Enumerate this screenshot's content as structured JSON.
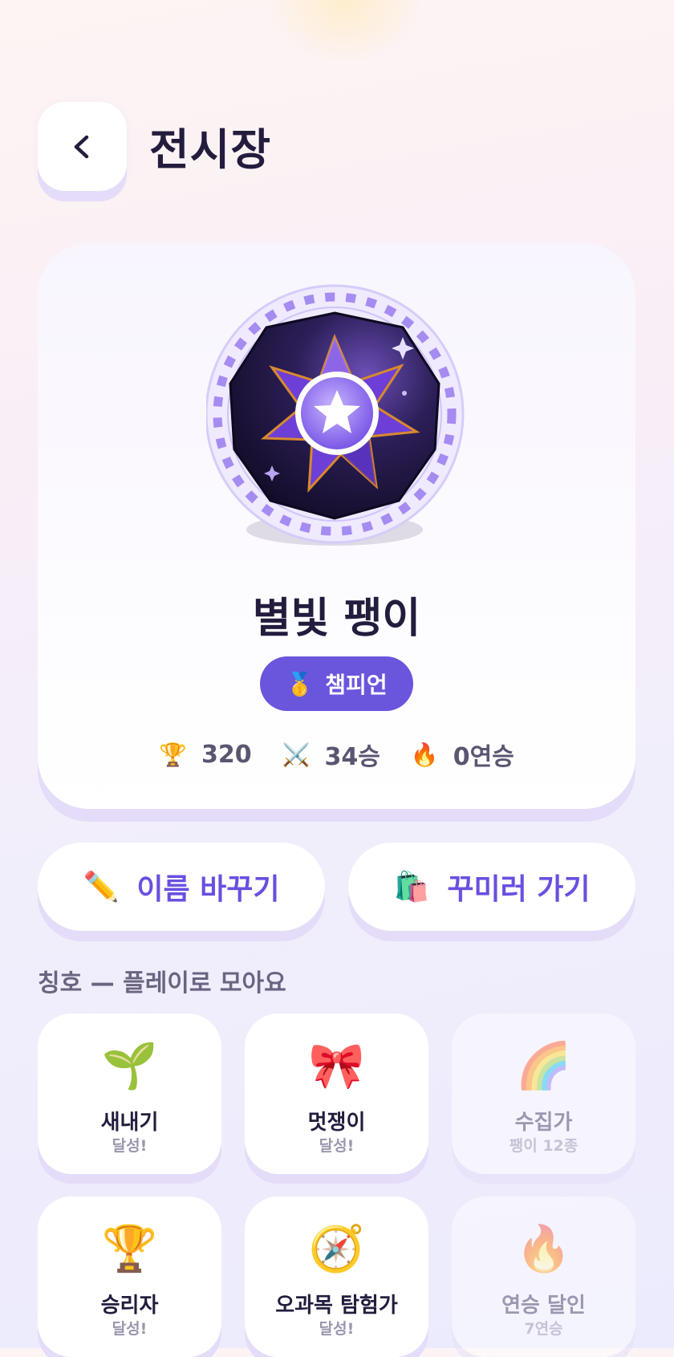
{
  "header": {
    "title": "전시장",
    "back_icon": "chevron-left-icon"
  },
  "profile": {
    "name": "별빛 팽이",
    "rank": {
      "icon": "🥇",
      "label": "챔피언"
    },
    "stats": [
      {
        "icon": "🏆",
        "icon_name": "trophy-icon",
        "value": "320"
      },
      {
        "icon": "⚔️",
        "icon_name": "crossed-swords-icon",
        "value": "34승"
      },
      {
        "icon": "🔥",
        "icon_name": "fire-icon",
        "value": "0연승"
      }
    ],
    "emblem_icon": "star-spinner-emblem-icon"
  },
  "actions": {
    "rename": {
      "icon": "✏️",
      "label": "이름 바꾸기"
    },
    "decorate": {
      "icon": "🛍️",
      "label": "꾸미러 가기"
    }
  },
  "titles": {
    "section_label": "칭호 — 플레이로 모아요",
    "items": [
      {
        "icon": "🌱",
        "icon_name": "sprout-icon",
        "name": "새내기",
        "status": "달성!",
        "locked": false
      },
      {
        "icon": "🎀",
        "icon_name": "ribbon-icon",
        "name": "멋쟁이",
        "status": "달성!",
        "locked": false
      },
      {
        "icon": "🌈",
        "icon_name": "rainbow-icon",
        "name": "수집가",
        "status": "팽이 12종",
        "locked": true
      },
      {
        "icon": "🏆",
        "icon_name": "trophy-icon",
        "name": "승리자",
        "status": "달성!",
        "locked": false
      },
      {
        "icon": "🧭",
        "icon_name": "compass-icon",
        "name": "오과목 탐험가",
        "status": "달성!",
        "locked": false
      },
      {
        "icon": "🔥",
        "icon_name": "fire-icon",
        "name": "연승 달인",
        "status": "7연승",
        "locked": true
      }
    ]
  },
  "colors": {
    "accent": "#6a55dd",
    "accent_text": "#6a4fe0",
    "title_text": "#231c3d",
    "card_shadow": "#e4dcf8"
  }
}
